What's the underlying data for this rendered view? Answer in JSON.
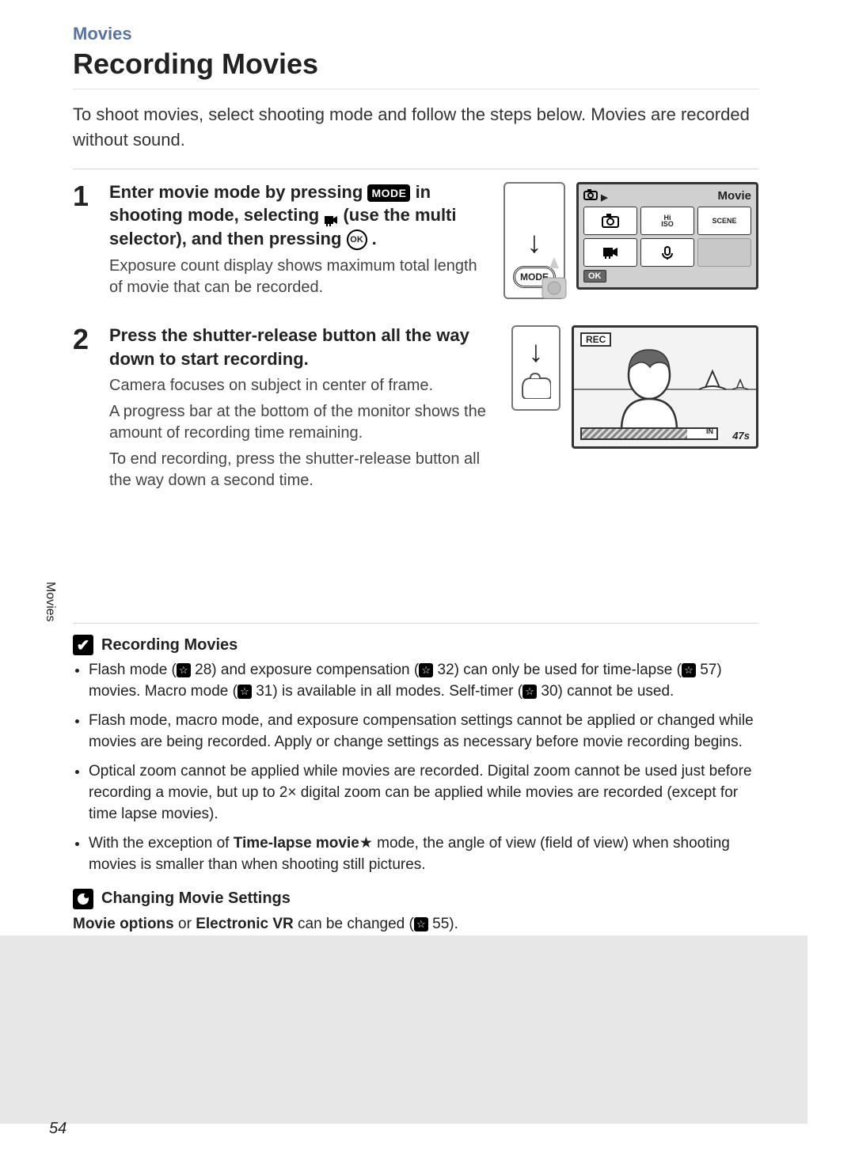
{
  "breadcrumb": "Movies",
  "title": "Recording Movies",
  "intro": "To shoot movies, select shooting mode and follow the steps below. Movies are recorded without sound.",
  "steps": [
    {
      "num": "1",
      "title_parts": {
        "a": "Enter movie mode by pressing ",
        "mode": "MODE",
        "b": " in shooting mode, selecting ",
        "c": " (use the multi selector), and then pressing ",
        "ok": "OK",
        "d": "."
      },
      "desc": [
        "Exposure count display shows maximum total length of movie that can be recorded."
      ],
      "screen": {
        "header_right": "Movie",
        "footer": "OK",
        "cells": [
          "📷",
          "Hi ISO",
          "SCENE",
          "🎥",
          "🎤",
          ""
        ]
      },
      "dial_label": "MODE"
    },
    {
      "num": "2",
      "title": "Press the shutter-release button all the way down to start recording.",
      "desc": [
        "Camera focuses on subject in center of frame.",
        "A progress bar at the bottom of the monitor shows the amount of recording time remaining.",
        "To end recording, press the shutter-release button all the way down a second time."
      ],
      "rec": {
        "label": "REC",
        "time": "47s",
        "in": "IN"
      }
    }
  ],
  "side_tab": "Movies",
  "notes": {
    "header": "Recording Movies",
    "bullets": [
      {
        "pre": "Flash mode (",
        "r1": "28",
        "mid1": ") and exposure compensation (",
        "r2": "32",
        "mid2": ") can only be used for time-lapse (",
        "r3": "57",
        "mid3": ") movies. Macro mode (",
        "r4": "31",
        "mid4": ") is available in all modes. Self-timer (",
        "r5": "30",
        "post": ") cannot be used."
      },
      {
        "text": "Flash mode, macro mode, and exposure compensation settings cannot be applied or changed while movies are being recorded. Apply or change settings as necessary before movie recording begins."
      },
      {
        "text": "Optical zoom cannot be applied while movies are recorded. Digital zoom cannot be used just before recording a movie, but up to 2× digital zoom can be applied while movies are recorded (except for time lapse movies)."
      },
      {
        "pre": "With the exception of ",
        "bold": "Time-lapse movie",
        "star": "★",
        "post": " mode, the angle of view (field of view) when shooting movies is smaller than when shooting still pictures."
      }
    ]
  },
  "settings": {
    "header": "Changing Movie Settings",
    "text_parts": {
      "a": "Movie options",
      "b": " or ",
      "c": "Electronic VR",
      "d": " can be changed (",
      "ref": "55",
      "e": ")."
    }
  },
  "page_number": "54"
}
